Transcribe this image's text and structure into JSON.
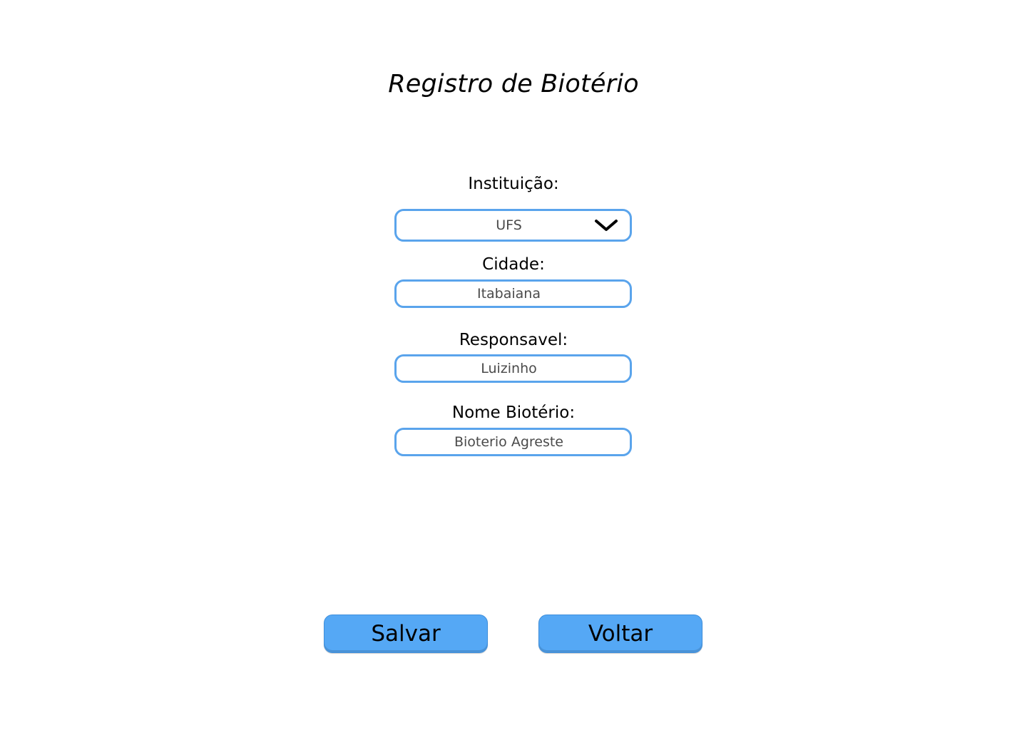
{
  "page": {
    "title": "Registro de Biotério"
  },
  "form": {
    "instituicao": {
      "label": "Instituição:",
      "value": "UFS",
      "icon": "chevron-down-icon"
    },
    "cidade": {
      "label": "Cidade:",
      "value": "Itabaiana"
    },
    "responsavel": {
      "label": "Responsavel:",
      "value": "Luizinho"
    },
    "nome_bioterio": {
      "label": "Nome Biotério:",
      "value": "Bioterio Agreste"
    }
  },
  "actions": {
    "save_label": "Salvar",
    "back_label": "Voltar"
  },
  "colors": {
    "accent": "#55a8f5",
    "field_border": "#5aa4ec"
  }
}
